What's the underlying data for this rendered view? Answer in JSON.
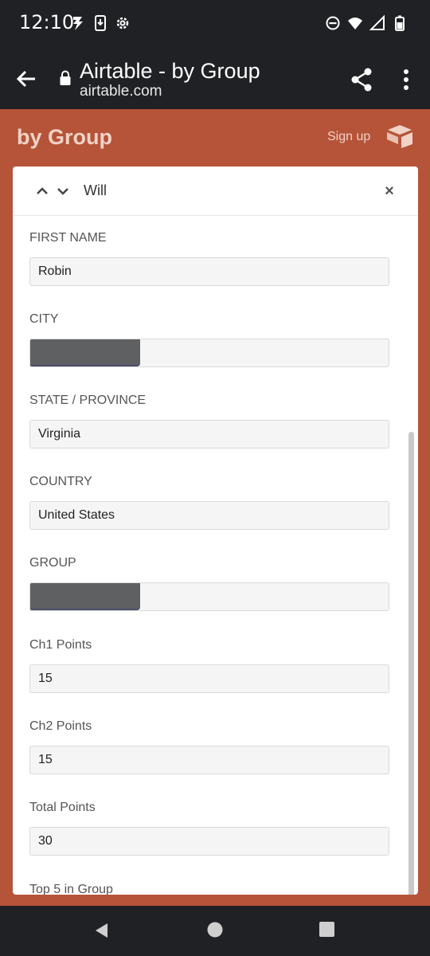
{
  "status_bar": {
    "time": "12:10",
    "left_icons": [
      "lightning-icon",
      "download-icon",
      "gear-icon"
    ],
    "right_icons": [
      "dnd-icon",
      "wifi-icon",
      "signal-icon",
      "battery-icon"
    ]
  },
  "browser": {
    "title": "Airtable - by Group",
    "url": "airtable.com"
  },
  "app": {
    "title": "by Group",
    "signup_label": "Sign up",
    "accent_color": "#b55438"
  },
  "record": {
    "name": "Will",
    "close_label": "×",
    "fields": [
      {
        "label": "FIRST NAME",
        "value": "Robin",
        "redacted": false
      },
      {
        "label": "CITY",
        "value": "",
        "redacted": true
      },
      {
        "label": "STATE / PROVINCE",
        "value": "Virginia",
        "redacted": false
      },
      {
        "label": "COUNTRY",
        "value": "United States",
        "redacted": false
      },
      {
        "label": "GROUP",
        "value": "",
        "redacted": true
      },
      {
        "label": "Ch1 Points",
        "value": "15",
        "redacted": false
      },
      {
        "label": "Ch2 Points",
        "value": "15",
        "redacted": false
      },
      {
        "label": "Total Points",
        "value": "30",
        "redacted": false
      },
      {
        "label": "Top 5 in Group",
        "value": "",
        "redacted": false
      }
    ]
  }
}
